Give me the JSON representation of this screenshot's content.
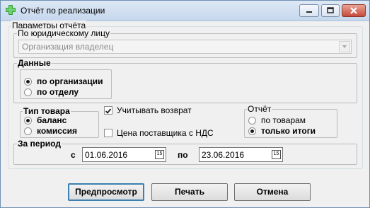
{
  "window": {
    "title": "Отчёт по реализации",
    "icon": "green-plus-icon",
    "controls": [
      "minimize-icon",
      "maximize-icon",
      "close-icon"
    ]
  },
  "params": {
    "legend": "Параметры отчёта",
    "legal_entity": {
      "legend": "По юридическому лицу",
      "combo_value": "Организация владелец",
      "enabled": false
    },
    "data": {
      "legend": "Данные",
      "options": [
        "по организации",
        "по отделу"
      ],
      "selected": 0
    },
    "goods_type": {
      "legend": "Тип товара",
      "options": [
        "баланс",
        "комиссия"
      ],
      "selected": 0
    },
    "checkboxes": [
      {
        "label": "Учитывать возврат",
        "checked": true
      },
      {
        "label": "Цена поставщика с НДС",
        "checked": false
      }
    ],
    "report": {
      "legend": "Отчёт",
      "options": [
        "по товарам",
        "только итоги"
      ],
      "selected": 1
    },
    "period": {
      "legend": "За период",
      "from_label": "с",
      "from_value": "01.06.2016",
      "to_label": "по",
      "to_value": "23.06.2016",
      "calendar_glyph": "15"
    }
  },
  "buttons": {
    "preview": "Предпросмотр",
    "print": "Печать",
    "cancel": "Отмена"
  }
}
